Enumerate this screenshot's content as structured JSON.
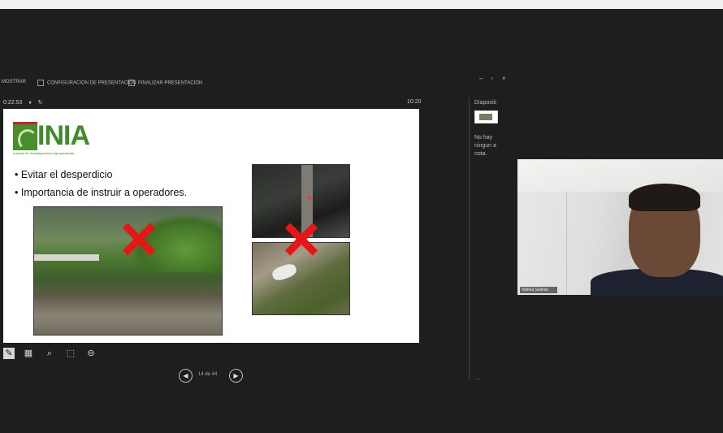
{
  "toolbar": {
    "items": [
      "MOSTRAR",
      "CONFIGURACIÓN DE PRESENTACIÓN",
      "FINALIZAR PRESENTACIÓN"
    ]
  },
  "window_controls": [
    "–",
    "▫",
    "×"
  ],
  "presenter": {
    "elapsed": "0:22:53",
    "clock": "10:20",
    "pause_icon": "pause-icon",
    "reset_icon": "reset-icon"
  },
  "slide": {
    "logo_text": "INIA",
    "logo_tagline": "Instituto de Investigaciones Agropecuarias",
    "bullets": [
      "Evitar el desperdicio",
      "Importancia de instruir a operadores."
    ],
    "accent": "#e51616",
    "brand": "#3f8a2a"
  },
  "tools": [
    "pen-icon",
    "slides-grid-icon",
    "zoom-icon",
    "pointer-icon",
    "more-icon"
  ],
  "navigation": {
    "counter": "14 de 44",
    "prev_icon": "chevron-left-icon",
    "next_icon": "chevron-right-icon"
  },
  "notes": {
    "title": "Diapositi",
    "text": "No hay ningun a nota.",
    "footer": "—"
  },
  "camera": {
    "participant_label": "Valeria Salinas"
  }
}
